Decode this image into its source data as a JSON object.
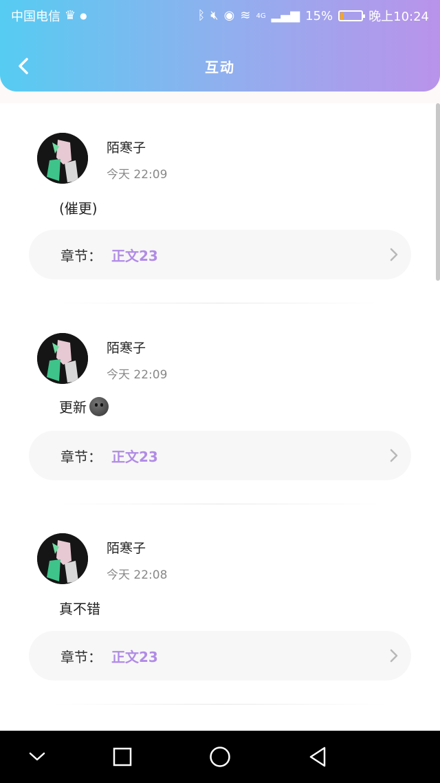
{
  "status_bar": {
    "carrier": "中国电信",
    "battery_percent": "15%",
    "battery_level": 0.15,
    "time": "晚上10:24",
    "network": "4G"
  },
  "header": {
    "title": "互动"
  },
  "comments": [
    {
      "username": "陌寒子",
      "time": "今天 22:09",
      "content": "(催更)",
      "has_emoji": false,
      "chapter_label": "章节：",
      "chapter_value": "正文23"
    },
    {
      "username": "陌寒子",
      "time": "今天 22:09",
      "content": "更新",
      "has_emoji": true,
      "chapter_label": "章节：",
      "chapter_value": "正文23"
    },
    {
      "username": "陌寒子",
      "time": "今天 22:08",
      "content": "真不错",
      "has_emoji": false,
      "chapter_label": "章节：",
      "chapter_value": "正文23"
    }
  ],
  "icons": {
    "back": "chevron-left-icon",
    "chapter_arrow": "chevron-right-icon",
    "nav_collapse": "chevron-down-icon",
    "nav_recent": "square-icon",
    "nav_home": "circle-icon",
    "nav_back": "triangle-back-icon"
  },
  "colors": {
    "header_gradient_start": "#56ccf2",
    "header_gradient_end": "#b993ea",
    "chapter_accent": "#b18be6"
  }
}
